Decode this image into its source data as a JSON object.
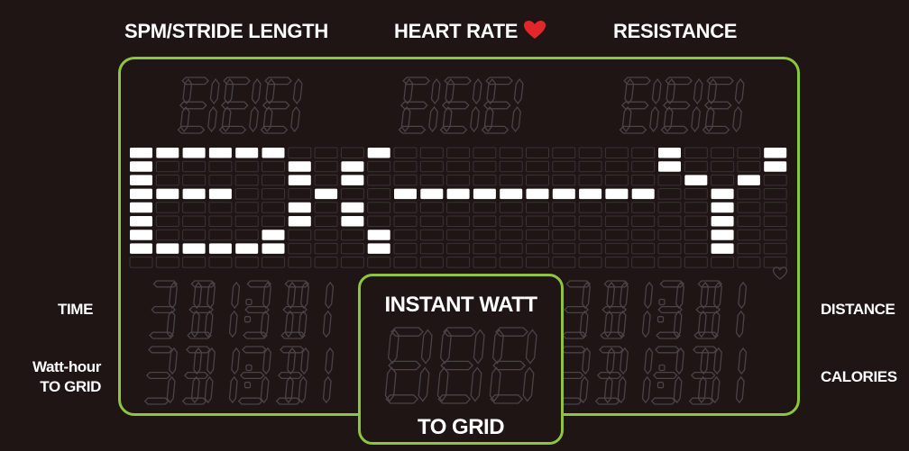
{
  "header": {
    "spm_label": "SPM/STRIDE LENGTH",
    "heart_rate_label": "HEART RATE",
    "resistance_label": "RESISTANCE",
    "heart_icon_color": "#e3262b"
  },
  "left_labels": {
    "time": "TIME",
    "watt_hour_line1": "Watt-hour",
    "watt_hour_line2": "TO GRID"
  },
  "right_labels": {
    "distance": "DISTANCE",
    "calories": "CALORIES"
  },
  "center_box": {
    "title": "INSTANT WATT",
    "subtitle": "TO GRID"
  },
  "dot_matrix": {
    "message": "EX--Y",
    "lit_color": "#ffffff",
    "unlit_color": "#3a3434"
  },
  "colors": {
    "frame": "#8cc63f",
    "background": "#1e1514",
    "segment_outline": "#4a4444"
  }
}
